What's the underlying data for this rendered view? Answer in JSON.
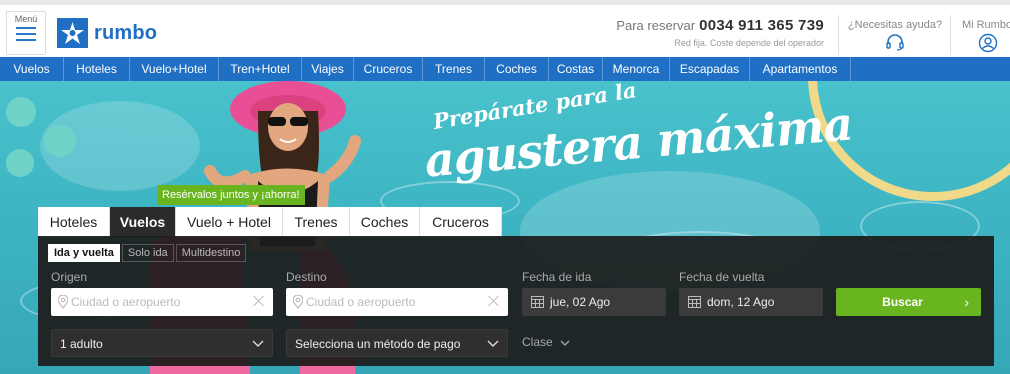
{
  "header": {
    "menu_label": "Menú",
    "logo_text": "rumbo",
    "reserve_label": "Para reservar",
    "phone": "0034 911 365 739",
    "phone_note": "Red fija. Coste depende del operador",
    "help_label": "¿Necesitas ayuda?",
    "account_label": "Mi Rumbo"
  },
  "nav": {
    "items": [
      "Vuelos",
      "Hoteles",
      "Vuelo+Hotel",
      "Tren+Hotel",
      "Viajes",
      "Cruceros",
      "Trenes",
      "Coches",
      "Costas",
      "Menorca",
      "Escapadas",
      "Apartamentos"
    ]
  },
  "hero": {
    "headline_small": "Prepárate para la",
    "headline_big": "agustera máxima",
    "promo": "Resérvalos juntos y ¡ahorra!"
  },
  "search": {
    "tabs": [
      "Hoteles",
      "Vuelos",
      "Vuelo + Hotel",
      "Trenes",
      "Coches",
      "Cruceros"
    ],
    "active_tab": "Vuelos",
    "trip_types": [
      "Ida y vuelta",
      "Solo ida",
      "Multidestino"
    ],
    "active_trip": "Ida y vuelta",
    "origin_label": "Origen",
    "origin_placeholder": "Ciudad o aeropuerto",
    "destination_label": "Destino",
    "destination_placeholder": "Ciudad o aeropuerto",
    "departure_label": "Fecha de ida",
    "departure_value": "jue, 02 Ago",
    "return_label": "Fecha de vuelta",
    "return_value": "dom, 12 Ago",
    "search_button": "Buscar",
    "passengers_value": "1 adulto",
    "payment_value": "Selecciona un método de pago",
    "class_label": "Clase"
  },
  "colors": {
    "brand_blue": "#1f6fc4",
    "search_green": "#69b51f",
    "panel_dark": "#1c1c1c"
  }
}
